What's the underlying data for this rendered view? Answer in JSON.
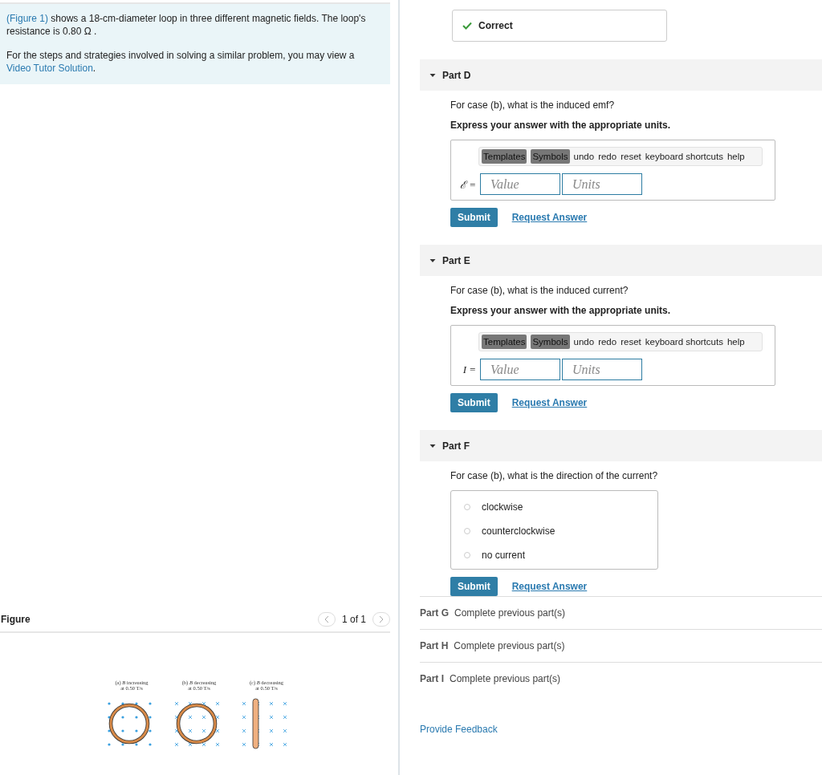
{
  "intro": {
    "text": "shows a 18-cm-diameter loop in three different magnetic fields. The loop's resistance is 0.80  Ω .",
    "figure_link": "(Figure 1)",
    "strategy": "For the steps and strategies involved in solving a similar problem, you may view a",
    "video_link": "Video Tutor Solution",
    "video_after": "."
  },
  "figure": {
    "title": "Figure",
    "pager": "1 of 1",
    "panels": [
      {
        "caption": [
          "(a) *B* increasing",
          "at 0.50 T/s"
        ],
        "kind": "dots"
      },
      {
        "caption": [
          "(b) *B* decreasing",
          "at 0.50 T/s"
        ],
        "kind": "crosses"
      },
      {
        "caption": [
          "(c) *B* decreasing",
          "at 0.50 T/s"
        ],
        "kind": "edgewise"
      }
    ]
  },
  "status": {
    "text": "Correct",
    "correct": true
  },
  "parts": [
    {
      "kind": "answer",
      "title": "Part D",
      "expanded": true,
      "question": "For case (b), what is the induced emf?",
      "instruction": "Express your answer with the appropriate units.",
      "symbol": "ℰ =",
      "toolbar": [
        "Templates",
        "Symbols",
        "undo",
        "redo",
        "reset",
        "keyboard shortcuts",
        "help"
      ],
      "value_placeholder": "Value",
      "units_placeholder": "Units",
      "submit": "Submit",
      "request": "Request Answer"
    },
    {
      "kind": "answer",
      "title": "Part E",
      "expanded": true,
      "question": "For case (b), what is the induced current?",
      "instruction": "Express your answer with the appropriate units.",
      "symbol": "I =",
      "toolbar": [
        "Templates",
        "Symbols",
        "undo",
        "redo",
        "reset",
        "keyboard shortcuts",
        "help"
      ],
      "value_placeholder": "Value",
      "units_placeholder": "Units",
      "submit": "Submit",
      "request": "Request Answer"
    },
    {
      "kind": "choice",
      "title": "Part F",
      "expanded": true,
      "question": "For case (b), what is the direction of the current?",
      "options": [
        {
          "label": "clockwise",
          "selected": false
        },
        {
          "label": "counterclockwise",
          "selected": false
        },
        {
          "label": "no current",
          "selected": false
        }
      ],
      "submit": "Submit",
      "request": "Request Answer"
    },
    {
      "kind": "locked",
      "title": "Part G",
      "note": "Complete previous part(s)"
    },
    {
      "kind": "locked",
      "title": "Part H",
      "note": "Complete previous part(s)"
    },
    {
      "kind": "locked",
      "title": "Part I",
      "note": "Complete previous part(s)"
    }
  ],
  "feedback": "Provide Feedback"
}
